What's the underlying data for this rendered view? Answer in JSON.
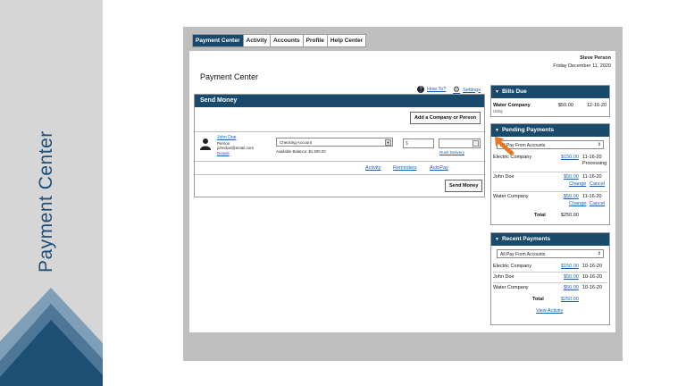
{
  "side_title": "Payment Center",
  "tabs": [
    "Payment Center",
    "Activity",
    "Accounts",
    "Profile",
    "Help Center"
  ],
  "user": {
    "name": "Steve Person",
    "date": "Friday December 11, 2020"
  },
  "page_title": "Payment Center",
  "help": {
    "how_to": "How To?",
    "settings": "Settings"
  },
  "send_money": {
    "title": "Send Money",
    "add_button": "Add a Company or Person",
    "payee": {
      "name": "John Doe",
      "type": "Person",
      "email": "johndoe@email.com",
      "details": "Details"
    },
    "account_select": "Checking Account",
    "available": "Available Balance: $1,500.00",
    "amount_placeholder": "$",
    "rush": "Rush Delivery",
    "links": {
      "activity": "Activity",
      "reminders": "Reminders",
      "autopay": "AutoPay"
    },
    "send_button": "Send Money"
  },
  "bills_due": {
    "title": "Bills Due",
    "items": [
      {
        "name": "Water Company",
        "category": "Utility",
        "amount": "$50.00",
        "date": "12-16-20"
      }
    ]
  },
  "pending": {
    "title": "Pending Payments",
    "select": "All Pay From Accounts",
    "items": [
      {
        "name": "Electric Company",
        "amount": "$150.00",
        "date": "11-16-20",
        "status": "Processing"
      },
      {
        "name": "John Doe",
        "amount": "$50.00",
        "date": "11-16-20",
        "change": "Change",
        "cancel": "Cancel"
      },
      {
        "name": "Water Company",
        "amount": "$50.00",
        "date": "11-16-20",
        "change": "Change",
        "cancel": "Cancel"
      }
    ],
    "total_label": "Total",
    "total": "$250.00"
  },
  "recent": {
    "title": "Recent Payments",
    "select": "All Pay From Accounts",
    "items": [
      {
        "name": "Electric Company",
        "amount": "$150.00",
        "date": "10-16-20"
      },
      {
        "name": "John Doe",
        "amount": "$50.00",
        "date": "10-16-20"
      },
      {
        "name": "Water Company",
        "amount": "$50.00",
        "date": "10-16-20"
      }
    ],
    "total_label": "Total",
    "total": "$250.00",
    "view_activity": "View Activity"
  },
  "colors": {
    "header_bar": "#1a4a6b",
    "accent_arrow": "#e87722",
    "side_title": "#1f4e79"
  }
}
